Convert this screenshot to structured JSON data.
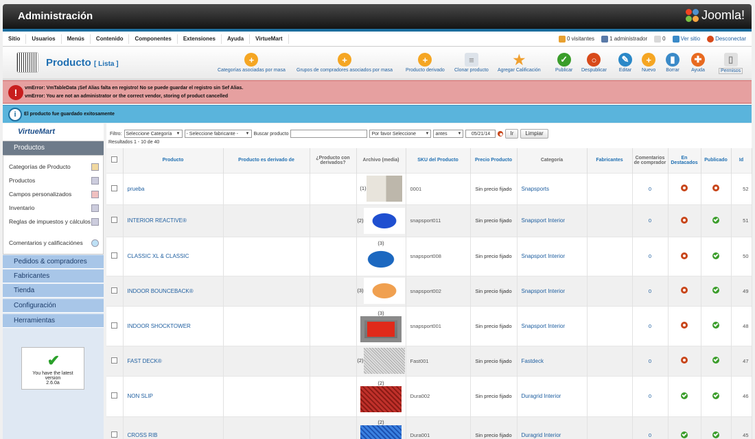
{
  "header": {
    "title": "Administración",
    "brand": "Joomla!"
  },
  "menu": {
    "items": [
      "Sitio",
      "Usuarios",
      "Menús",
      "Contenido",
      "Componentes",
      "Extensiones",
      "Ayuda",
      "VirtueMart"
    ],
    "visitors": "0 visitantes",
    "admins": "1 administrador",
    "messages": "0",
    "view_site": "Ver sitio",
    "logout": "Desconectar"
  },
  "toolbar": {
    "title": "Producto",
    "subtitle": "[ Lista ]",
    "buttons": [
      {
        "label": "Categorías asociadas por masa",
        "color": "#f5a623",
        "glyph": "+"
      },
      {
        "label": "Grupos de compradores asociados por masa",
        "color": "#f5a623",
        "glyph": "+"
      },
      {
        "label": "Producto derivado",
        "color": "#f5a623",
        "glyph": "+"
      },
      {
        "label": "Clonar producto",
        "color": "#dde3ea",
        "glyph": "≡"
      },
      {
        "label": "Agregar Calificación",
        "color": "#f0a030",
        "glyph": "★"
      },
      {
        "label": "Publicar",
        "color": "#3a9d2a",
        "glyph": "✓"
      },
      {
        "label": "Despublicar",
        "color": "#d84a1a",
        "glyph": "○"
      },
      {
        "label": "Editar",
        "color": "#2a88c8",
        "glyph": "✎"
      },
      {
        "label": "Nuevo",
        "color": "#f5a623",
        "glyph": "+"
      },
      {
        "label": "Borrar",
        "color": "#3a8ac8",
        "glyph": "▮"
      },
      {
        "label": "Ayuda",
        "color": "#e86a20",
        "glyph": "✚"
      },
      {
        "label": "Permisos",
        "color": "#e0e0e0",
        "glyph": "▯"
      }
    ]
  },
  "errors": [
    "vmError: VmTableData ¡Sef Alias falta en registro! No se puede guardar el registro sin Sef Alias.",
    "vmError: You are not an administrator or the correct vendor, storing of product cancelled"
  ],
  "info": "El producto fue guardado exitosamente",
  "sidebar": {
    "logo": "VirtueMart",
    "section": "Productos",
    "items": [
      "Categorías de Producto",
      "Productos",
      "Campos personalizados",
      "Inventario",
      "Reglas de impuestos y cálculos",
      "Comentarios y calificaciónes"
    ],
    "categories": [
      "Pedidos & compradores",
      "Fabricantes",
      "Tienda",
      "Configuración",
      "Herramientas"
    ],
    "version": {
      "line1": "You have the latest",
      "line2": "version",
      "line3": "2.6.0a"
    }
  },
  "filter": {
    "label": "Filtro:",
    "category": "Seleccione Categoría",
    "manufacturer": "- Seleccione fabricante -",
    "search_label": "Buscar producto",
    "search_value": "",
    "order": "Por favor Seleccione",
    "date_mode": "antes",
    "date": "05/21/14",
    "go": "Ir",
    "clear": "Limpiar"
  },
  "results": "Resultados 1 - 10 de 40",
  "columns": [
    "Producto",
    "Producto es derivado de",
    "¿Producto con derivados?",
    "Archivo (media)",
    "SKU del Producto",
    "Precio Producto",
    "Categoría",
    "Fabricantes",
    "Comentarios de comprador",
    "En Destacados",
    "Publicado",
    "Id"
  ],
  "rows": [
    {
      "name": "prueba",
      "media": "(1)",
      "sku": "0001",
      "price": "Sin precio fijado",
      "cat": "Snapsports",
      "comments": "0",
      "featured": false,
      "published": false,
      "id": "52",
      "thumb": "room"
    },
    {
      "name": "INTERIOR REACTIVE®",
      "media": "(2)",
      "sku": "snapsport011",
      "price": "Sin precio fijado",
      "cat": "Snapsport Interior",
      "comments": "0",
      "featured": false,
      "published": true,
      "id": "51",
      "thumb": "blue"
    },
    {
      "name": "CLASSIC XL & CLASSIC",
      "media": "(3)",
      "sku": "snapsport008",
      "price": "Sin precio fijado",
      "cat": "Snapsport Interior",
      "comments": "0",
      "featured": false,
      "published": true,
      "id": "50",
      "thumb": "blue2"
    },
    {
      "name": "INDOOR BOUNCEBACK®",
      "media": "(3)",
      "sku": "snapsport002",
      "price": "Sin precio fijado",
      "cat": "Snapsport Interior",
      "comments": "0",
      "featured": false,
      "published": true,
      "id": "49",
      "thumb": "orange"
    },
    {
      "name": "INDOOR SHOCKTOWER",
      "media": "(3)",
      "sku": "snapsport001",
      "price": "Sin precio fijado",
      "cat": "Snapsport Interior",
      "comments": "0",
      "featured": false,
      "published": true,
      "id": "48",
      "thumb": "red"
    },
    {
      "name": "FAST DECK®",
      "media": "(2)",
      "sku": "Fast001",
      "price": "Sin precio fijado",
      "cat": "Fastdeck",
      "comments": "0",
      "featured": false,
      "published": true,
      "id": "47",
      "thumb": "white"
    },
    {
      "name": "NON SLIP",
      "media": "(2)",
      "sku": "Dura002",
      "price": "Sin precio fijado",
      "cat": "Duragrid Interior",
      "comments": "0",
      "featured": true,
      "published": true,
      "id": "46",
      "thumb": "redgrid"
    },
    {
      "name": "CROSS RIB",
      "media": "(2)",
      "sku": "Dura001",
      "price": "Sin precio fijado",
      "cat": "Duragrid Interior",
      "comments": "0",
      "featured": true,
      "published": true,
      "id": "45",
      "thumb": "bluegrid"
    }
  ]
}
